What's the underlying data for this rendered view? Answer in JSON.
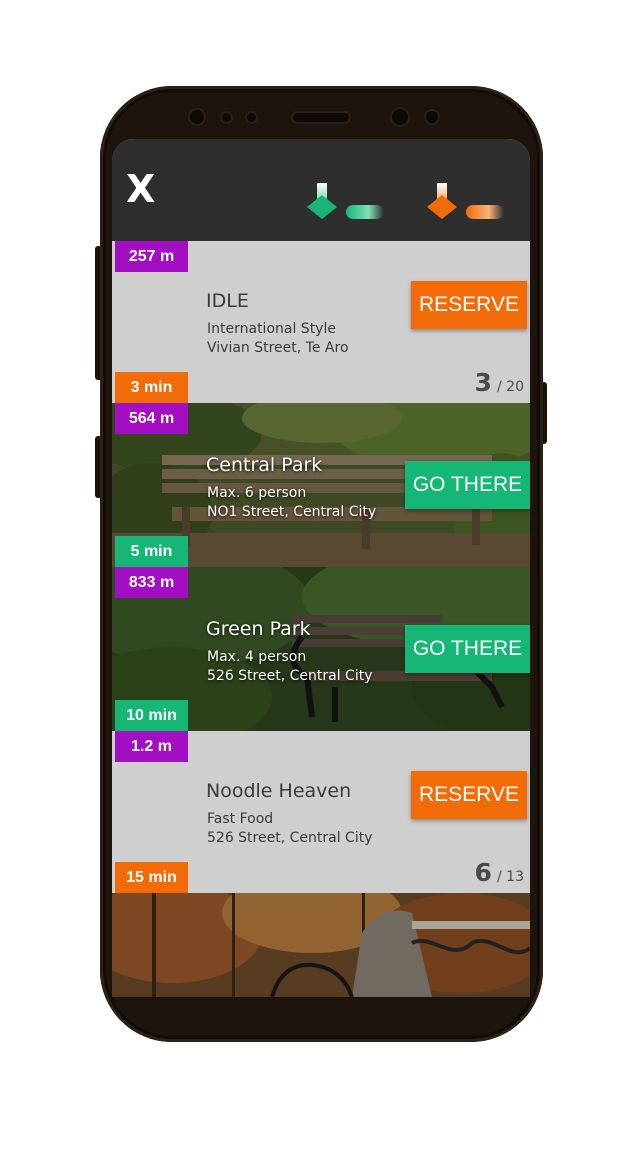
{
  "header": {
    "close_label": "X",
    "legend_free_color": "#15b676",
    "legend_reserve_color": "#f16c08"
  },
  "cards": [
    {
      "kind": "reserve",
      "distance": "257 m",
      "time": "3 min",
      "title": "IDLE",
      "line1": "International Style",
      "line2": "Vivian Street, Te Aro",
      "button": "RESERVE",
      "count": "3",
      "total": "/ 20"
    },
    {
      "kind": "park",
      "distance": "564 m",
      "time": "5 min",
      "title": "Central Park",
      "line1": "Max. 6 person",
      "line2": "NO1 Street, Central City",
      "button": "GO THERE"
    },
    {
      "kind": "park",
      "distance": "833 m",
      "time": "10 min",
      "title": "Green Park",
      "line1": "Max. 4 person",
      "line2": "526 Street, Central City",
      "button": "GO THERE"
    },
    {
      "kind": "reserve",
      "distance": "1.2 m",
      "time": "15 min",
      "title": "Noodle Heaven",
      "line1": "Fast Food",
      "line2": "526 Street, Central City",
      "button": "RESERVE",
      "count": "6",
      "total": "/ 13"
    }
  ],
  "colors": {
    "distance_badge": "#a20ec1",
    "orange": "#f16c08",
    "green": "#15b676",
    "topbar": "#2e2e2e"
  }
}
